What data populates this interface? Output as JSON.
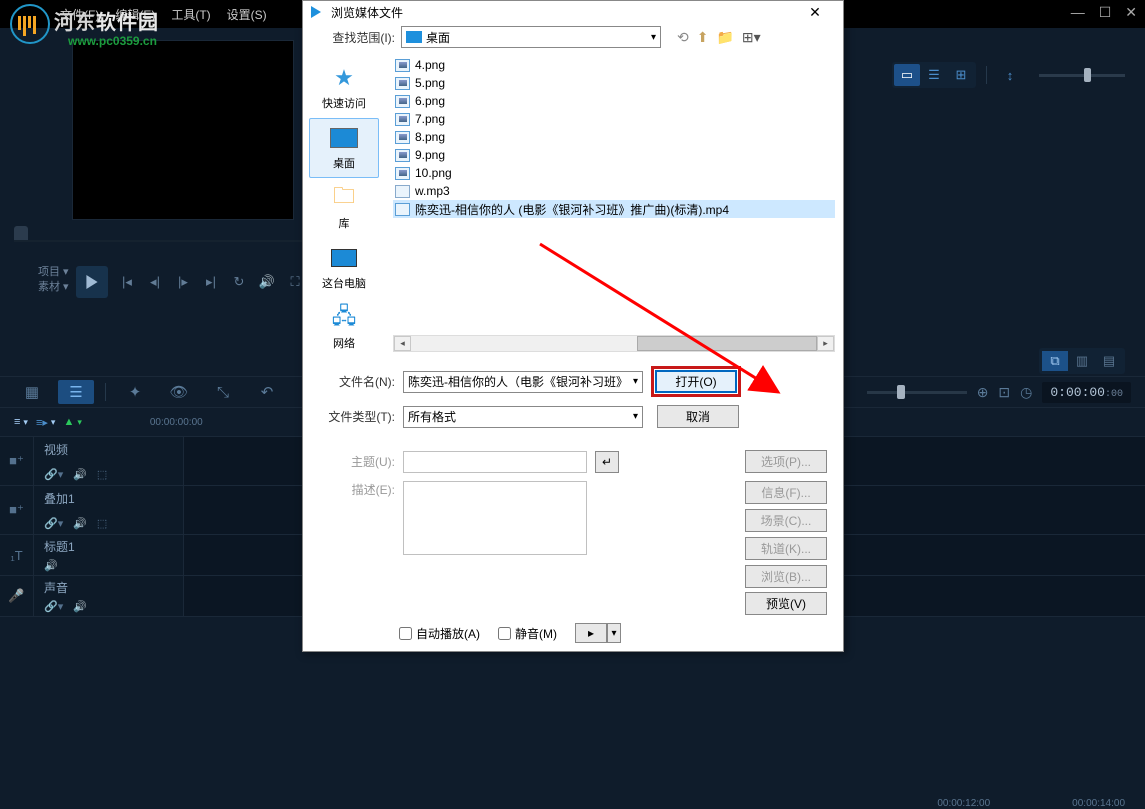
{
  "menu": {
    "file": "文件(F)",
    "edit": "编辑(E)",
    "tool": "工具(T)",
    "settings": "设置(S)"
  },
  "logo": {
    "text1": "河东",
    "text2": "软件园",
    "url": "www.pc0359.cn"
  },
  "player": {
    "project": "项目 ▾",
    "material": "素材 ▾"
  },
  "dialog": {
    "title": "浏览媒体文件",
    "lookin_label": "查找范围(I):",
    "lookin_value": "桌面",
    "sidebar": {
      "quick": "快速访问",
      "desktop": "桌面",
      "library": "库",
      "thispc": "这台电脑",
      "network": "网络"
    },
    "files": [
      "4.png",
      "5.png",
      "6.png",
      "7.png",
      "8.png",
      "9.png",
      "10.png",
      "w.mp3",
      "陈奕迅-相信你的人 (电影《银河补习班》推广曲)(标清).mp4"
    ],
    "filename_label": "文件名(N):",
    "filename_value": "陈奕迅-相信你的人（电影《银河补习班》",
    "filetype_label": "文件类型(T):",
    "filetype_value": "所有格式",
    "subject_label": "主题(U):",
    "desc_label": "描述(E):",
    "autoplay": "自动播放(A)",
    "mute": "静音(M)",
    "open": "打开(O)",
    "cancel": "取消",
    "options": "选项(P)...",
    "info": "信息(F)...",
    "scene": "场景(C)...",
    "track": "轨道(K)...",
    "browse": "浏览(B)...",
    "preview": "预览(V)"
  },
  "timeline": {
    "tc": "0:00:00",
    "btns": {
      "add": "+",
      "menu": "≡▸"
    },
    "time1": "00:00:00:00",
    "right_times": [
      "00:00:12:00",
      "00:00:14:00"
    ],
    "tracks": {
      "video": "视频",
      "overlay": "叠加1",
      "title": "标题1",
      "audio": "声音"
    }
  }
}
